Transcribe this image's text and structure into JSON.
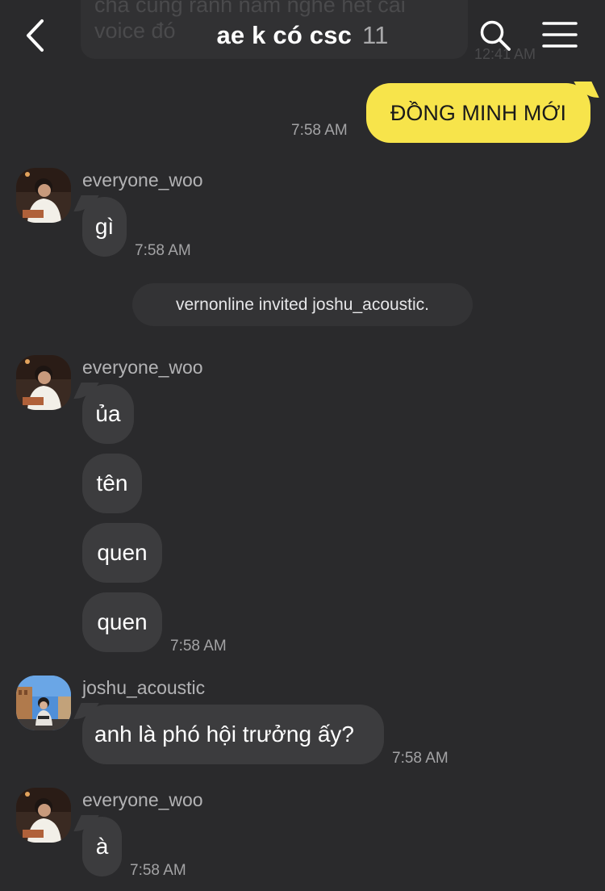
{
  "header": {
    "title": "ae k có csc",
    "member_count": "11",
    "back_icon": "chevron-left-icon",
    "search_icon": "search-icon",
    "menu_icon": "hamburger-menu-icon"
  },
  "previous_message": {
    "text": "cha cũng rảnh nằm nghe hết cái voice đó",
    "time": "12:41 AM"
  },
  "messages": [
    {
      "sender": "me",
      "text": "ĐỒNG MINH MỚI",
      "time": "7:58 AM"
    },
    {
      "sender": "everyone_woo",
      "text": "gì",
      "time": "7:58 AM"
    },
    {
      "system": "vernonline invited joshu_acoustic."
    },
    {
      "sender": "everyone_woo",
      "texts": [
        "ủa",
        "tên",
        "quen",
        "quen"
      ],
      "time": "7:58 AM"
    },
    {
      "sender": "joshu_acoustic",
      "text": "anh là phó hội trưởng ấy?",
      "time": "7:58 AM"
    },
    {
      "sender": "everyone_woo",
      "text": "à",
      "time": "7:58 AM"
    }
  ],
  "colors": {
    "background": "#2a2a2c",
    "bubble_other": "#3c3c3e",
    "bubble_mine": "#f7e44b",
    "timestamp": "#a3a3a5"
  }
}
